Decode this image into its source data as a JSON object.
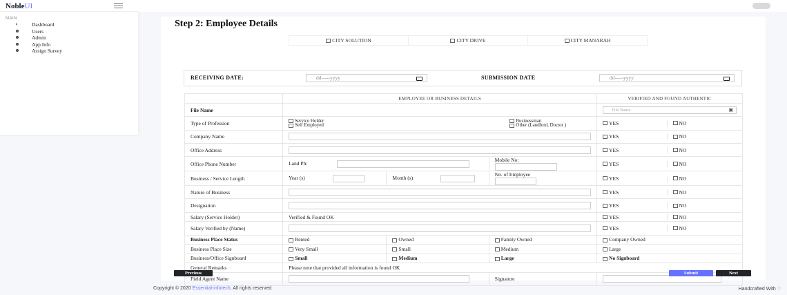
{
  "brand": {
    "name": "Noble",
    "suffix": "UI"
  },
  "sidebar": {
    "category": "MAIN",
    "items": [
      {
        "icon": "dashboard-icon",
        "label": "Dashboard"
      },
      {
        "icon": "users-icon",
        "label": "Users"
      },
      {
        "icon": "admin-icon",
        "label": "Admin"
      },
      {
        "icon": "app-info-icon",
        "label": "App Info"
      },
      {
        "icon": "assign-survey-icon",
        "label": "Assign Survey"
      }
    ]
  },
  "page": {
    "title": "Step 2: Employee Details"
  },
  "cities": [
    "CITY SOLUTION",
    "CITY DRIVE",
    "CITY MANARAH"
  ],
  "dates": {
    "receiving_label": "RECEIVING DATE:",
    "submission_label": "SUBMISSION DATE",
    "placeholder": "dd-----yyyy"
  },
  "table": {
    "header_left": "EMPLOYEE OR BUSINESS DETAILS",
    "header_right": "VERIFIED AND FOUND AUTHENTIC",
    "file_name_label": "File Name",
    "file_name_placeholder": "File Name",
    "yes": "YES",
    "no": "NO",
    "rows": {
      "profession": "Type of Profession",
      "company": "Company Name",
      "office_address": "Office Address",
      "office_phone": "Office Phone Number",
      "business_length": "Business / Service Length",
      "nature": "Nature of Business",
      "designation": "Designation",
      "salary": "Salary (Service Holder)",
      "salary_verified": "Salary Verified by (Name)",
      "place_status": "Business Place Status",
      "place_size": "Business Place Size",
      "signboard": "Business/Office Signboard",
      "remarks": "General Remarks",
      "agent": "Field Agent Name"
    },
    "profession_options": [
      "Service Holder",
      "Self Employed",
      "Businessman",
      "Other (Landlord, Doctor )"
    ],
    "land_ph": "Land Ph:",
    "mobile_no": "Mobile No:",
    "year": "Year (s)",
    "month": "Month (s)",
    "no_employee": "No. of Employee",
    "salary_value": "Verified & Found OK",
    "status_options": [
      "Rented",
      "Owned",
      "Family Owned",
      "Company Owned"
    ],
    "size_options": [
      "Very Small",
      "Small",
      "Medium",
      "Large"
    ],
    "signboard_options": [
      "Small",
      "Medium",
      "Large",
      "No Signboard"
    ],
    "remarks_value": "Please note that provided all information is found OK",
    "signature": "Signature"
  },
  "buttons": {
    "previous": "Previous",
    "submit": "Submit",
    "next": "Next"
  },
  "footer": {
    "prefix": "Copyright © 2020 ",
    "link": "Essential-infotech",
    "suffix": ". All rights reserved",
    "handcrafted": "Handcrafted With"
  },
  "colors": {
    "accent": "#6571ff",
    "dark": "#212529"
  }
}
